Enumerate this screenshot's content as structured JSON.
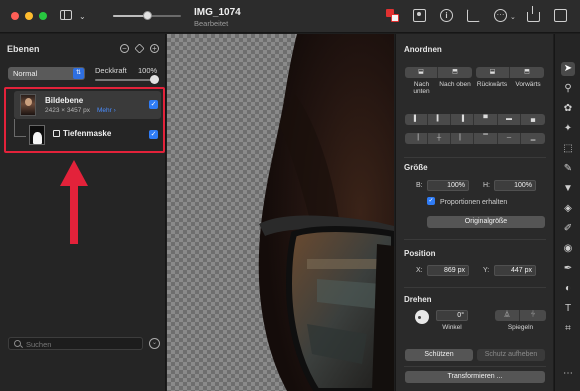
{
  "window": {
    "title": "IMG_1074",
    "subtitle": "Bearbeitet",
    "zoom_level": 0.55
  },
  "layers_panel": {
    "title": "Ebenen",
    "blend_mode": "Normal",
    "opacity_label": "Deckkraft",
    "opacity_value": "100%",
    "layers": [
      {
        "name": "Bildebene",
        "dimensions": "2423 × 3457 px",
        "more_label": "Mehr ›",
        "visible": true
      },
      {
        "name": "Tiefenmaske",
        "visible": true
      }
    ],
    "search_placeholder": "Suchen"
  },
  "arrange_panel": {
    "title": "Anordnen",
    "order_buttons": [
      {
        "label": "Nach unten"
      },
      {
        "label": "Nach oben"
      },
      {
        "label": "Rückwärts"
      },
      {
        "label": "Vorwärts"
      }
    ],
    "size": {
      "title": "Größe",
      "b_label": "B:",
      "b_value": "100%",
      "h_label": "H:",
      "h_value": "100%",
      "proportions_label": "Proportionen erhalten",
      "proportions_checked": true,
      "original_size_button": "Originalgröße"
    },
    "position": {
      "title": "Position",
      "x_label": "X:",
      "x_value": "869 px",
      "y_label": "Y:",
      "y_value": "447 px"
    },
    "rotate": {
      "title": "Drehen",
      "angle_value": "0°",
      "angle_label": "Winkel",
      "mirror_label": "Spiegeln"
    },
    "protect_button": "Schützen",
    "unprotect_button": "Schutz aufheben",
    "transform_button": "Transformieren ..."
  },
  "colors": {
    "accent_blue": "#2f7cf6",
    "highlight_red": "#e3223a",
    "traffic_red": "#fe5f57",
    "traffic_yellow": "#febc2e",
    "traffic_green": "#28c840"
  },
  "tools": [
    "arrow-icon",
    "brush-icon",
    "retouch-icon",
    "magic-icon",
    "select-icon",
    "pen-icon",
    "bucket-icon",
    "eraser-icon",
    "pencil-icon",
    "color-icon",
    "vector-pen-icon",
    "shape-icon",
    "text-icon",
    "crop-icon"
  ]
}
